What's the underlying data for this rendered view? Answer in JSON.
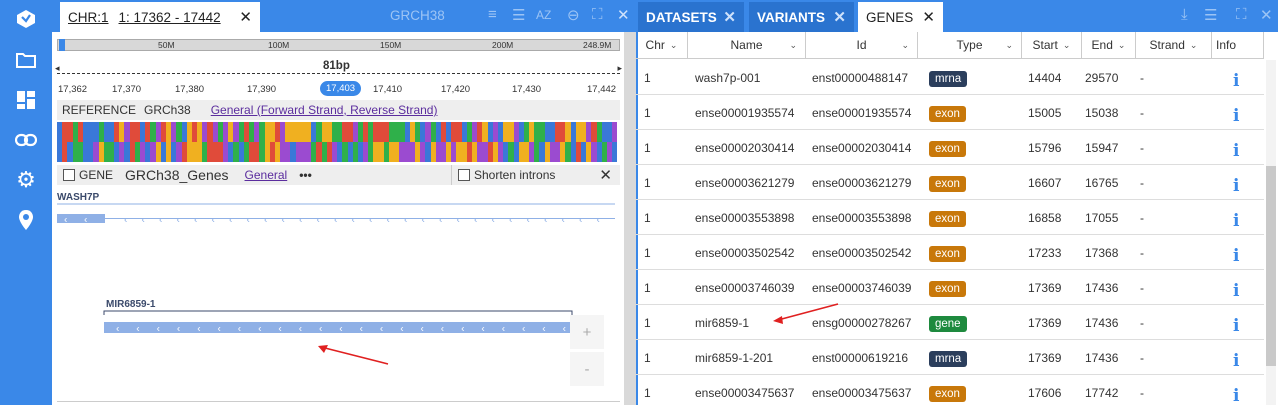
{
  "left": {
    "tab": {
      "label": "CHR:1",
      "range": "1: 17362 - 17442"
    },
    "toolbar": {
      "assembly": "GRCH38"
    },
    "ruler": {
      "labels": [
        "50M",
        "100M",
        "150M",
        "200M",
        "248.9M"
      ]
    },
    "bp": "81bp",
    "ticks": [
      "17,362",
      "17,370",
      "17,380",
      "17,390",
      "17,403",
      "17,410",
      "17,420",
      "17,430",
      "17,442"
    ],
    "ref": {
      "label": "REFERENCE",
      "genome": "GRCh38",
      "link": "General (Forward Strand, Reverse Strand)"
    },
    "genes": {
      "check_label": "GENE",
      "title": "GRCh38_Genes",
      "link": "General",
      "more": "•••",
      "shorten": "Shorten introns"
    },
    "track": {
      "gene1": "WASH7P",
      "gene2": "MIR6859-1"
    },
    "zoom": {
      "plus": "+",
      "minus": "-"
    }
  },
  "right": {
    "tabs": [
      "DATASETS",
      "VARIANTS",
      "GENES"
    ],
    "columns": [
      "Chr",
      "Name",
      "Id",
      "Type",
      "Start",
      "End",
      "Strand",
      "Info"
    ],
    "rows": [
      {
        "chr": "1",
        "name": "wash7p-001",
        "id": "enst00000488147",
        "type": "mrna",
        "start": "14404",
        "end": "29570",
        "strand": "-"
      },
      {
        "chr": "1",
        "name": "ense00001935574",
        "id": "ense00001935574",
        "type": "exon",
        "start": "15005",
        "end": "15038",
        "strand": "-"
      },
      {
        "chr": "1",
        "name": "ense00002030414",
        "id": "ense00002030414",
        "type": "exon",
        "start": "15796",
        "end": "15947",
        "strand": "-"
      },
      {
        "chr": "1",
        "name": "ense00003621279",
        "id": "ense00003621279",
        "type": "exon",
        "start": "16607",
        "end": "16765",
        "strand": "-"
      },
      {
        "chr": "1",
        "name": "ense00003553898",
        "id": "ense00003553898",
        "type": "exon",
        "start": "16858",
        "end": "17055",
        "strand": "-"
      },
      {
        "chr": "1",
        "name": "ense00003502542",
        "id": "ense00003502542",
        "type": "exon",
        "start": "17233",
        "end": "17368",
        "strand": "-"
      },
      {
        "chr": "1",
        "name": "ense00003746039",
        "id": "ense00003746039",
        "type": "exon",
        "start": "17369",
        "end": "17436",
        "strand": "-"
      },
      {
        "chr": "1",
        "name": "mir6859-1",
        "id": "ensg00000278267",
        "type": "gene",
        "start": "17369",
        "end": "17436",
        "strand": "-"
      },
      {
        "chr": "1",
        "name": "mir6859-1-201",
        "id": "enst00000619216",
        "type": "mrna",
        "start": "17369",
        "end": "17436",
        "strand": "-"
      },
      {
        "chr": "1",
        "name": "ense00003475637",
        "id": "ense00003475637",
        "type": "exon",
        "start": "17606",
        "end": "17742",
        "strand": "-"
      }
    ],
    "info_glyph": "i"
  },
  "colors": {
    "accent": "#3a88e8",
    "mrna": "#2b3e5c",
    "exon": "#c8780a",
    "gene": "#1e8a3e",
    "arrow": "#e02020",
    "gene_track": "#8fb0e6"
  }
}
